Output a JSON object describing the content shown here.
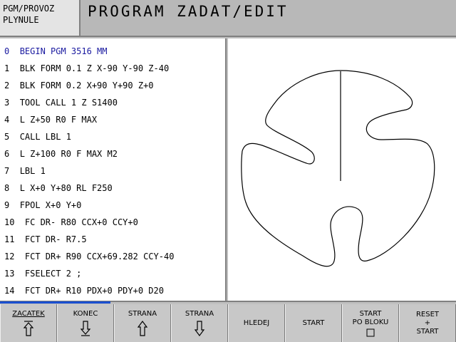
{
  "header": {
    "mode_line1": "PGM/PROVOZ",
    "mode_line2": "PLYNULE",
    "title": "PROGRAM ZADAT/EDIT"
  },
  "program": {
    "lines": [
      {
        "num": "0",
        "text": "BEGIN PGM 3516 MM"
      },
      {
        "num": "1",
        "text": "BLK FORM 0.1 Z X-90 Y-90 Z-40"
      },
      {
        "num": "2",
        "text": "BLK FORM 0.2 X+90 Y+90 Z+0"
      },
      {
        "num": "3",
        "text": "TOOL CALL 1 Z S1400"
      },
      {
        "num": "4",
        "text": "L Z+50 R0 F MAX"
      },
      {
        "num": "5",
        "text": "CALL LBL 1"
      },
      {
        "num": "6",
        "text": "L Z+100 R0 F MAX M2"
      },
      {
        "num": "7",
        "text": "LBL 1"
      },
      {
        "num": "8",
        "text": "L X+0 Y+80 RL F250"
      },
      {
        "num": "9",
        "text": "FPOL X+0 Y+0"
      },
      {
        "num": "10",
        "text": "FC DR- R80 CCX+0 CCY+0"
      },
      {
        "num": "11",
        "text": "FCT DR- R7.5"
      },
      {
        "num": "12",
        "text": "FCT DR+ R90 CCX+69.282 CCY-40"
      },
      {
        "num": "13",
        "text": "FSELECT 2 ;"
      },
      {
        "num": "14",
        "text": "FCT DR+ R10 PDX+0 PDY+0 D20"
      }
    ]
  },
  "softkeys": [
    {
      "label": "ZACATEK",
      "icon": "arrow-up-bar-icon"
    },
    {
      "label": "KONEC",
      "icon": "arrow-down-bar-icon"
    },
    {
      "label": "STRANA",
      "icon": "arrow-up-icon"
    },
    {
      "label": "STRANA",
      "icon": "arrow-down-icon"
    },
    {
      "label": "HLEDEJ",
      "icon": ""
    },
    {
      "label": "START",
      "icon": ""
    },
    {
      "label": "START\nPO BLOKU",
      "icon": "checkbox-icon"
    },
    {
      "label": "RESET\n+\nSTART",
      "icon": ""
    }
  ]
}
